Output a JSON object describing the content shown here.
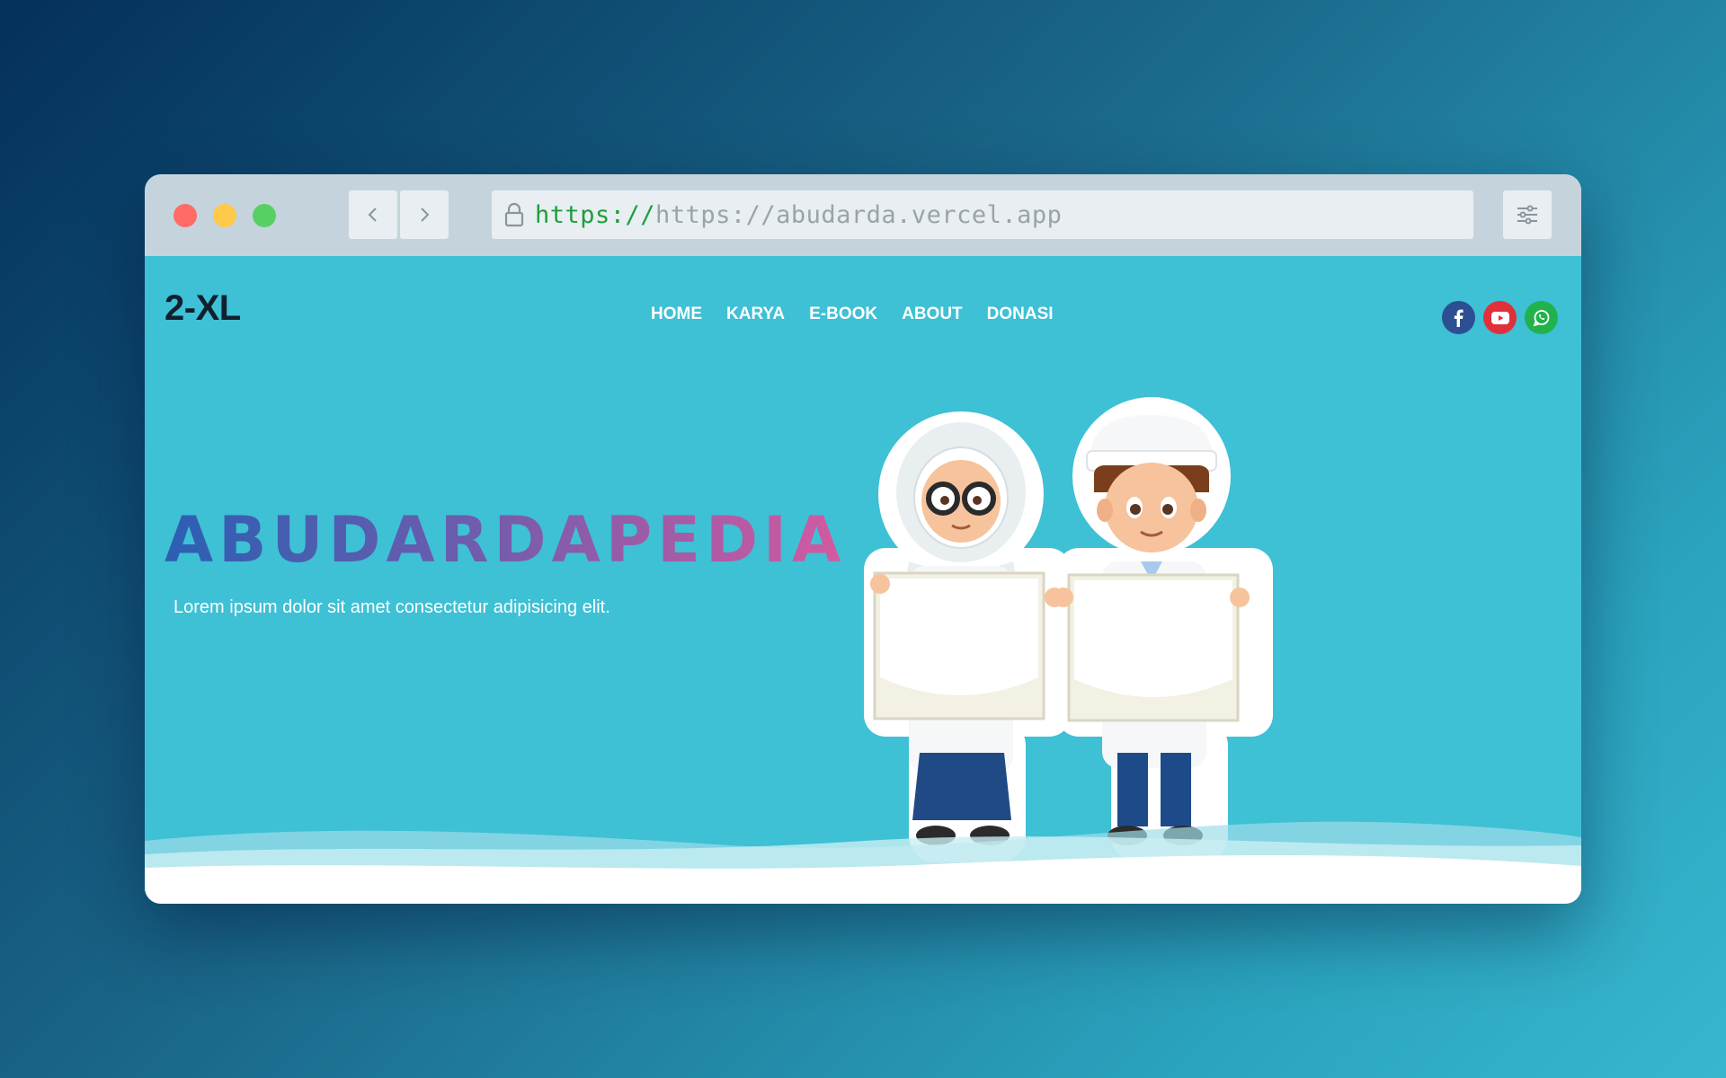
{
  "browser": {
    "url_protocol": "https://",
    "url_rest": "https://abudarda.vercel.app"
  },
  "site": {
    "logo": "2-XL",
    "nav": [
      "HOME",
      "KARYA",
      "E-BOOK",
      "ABOUT",
      "DONASI"
    ],
    "social": [
      "facebook-icon",
      "youtube-icon",
      "whatsapp-icon"
    ]
  },
  "hero": {
    "title": "ABUDARDAPEDIA",
    "subtitle": "Lorem ipsum dolor sit amet consectetur adipisicing elit."
  },
  "colors": {
    "page_bg": "#3ec0d5",
    "facebook": "#2c4f93",
    "youtube": "#e0303a",
    "whatsapp": "#22b24c"
  }
}
